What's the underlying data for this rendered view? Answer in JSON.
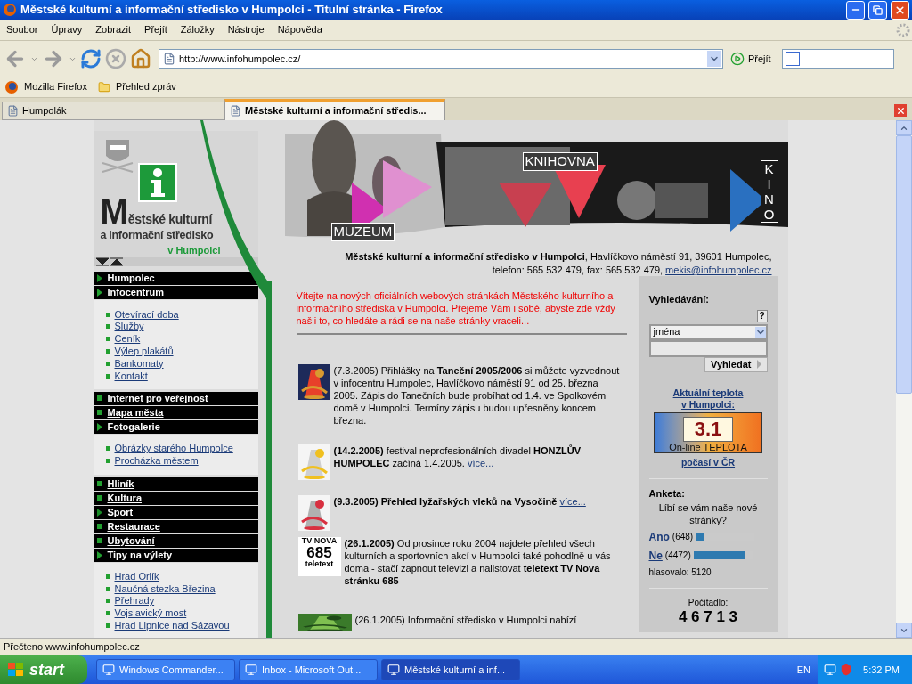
{
  "window": {
    "title": "Městské kulturní a informační středisko v Humpolci - Titulní stránka - Firefox"
  },
  "menu": [
    "Soubor",
    "Úpravy",
    "Zobrazit",
    "Přejít",
    "Záložky",
    "Nástroje",
    "Nápověda"
  ],
  "toolbar": {
    "url": "http://www.infohumpolec.cz/",
    "go": "Přejít"
  },
  "bookmarks": [
    "Mozilla Firefox",
    "Přehled zpráv"
  ],
  "tabs": [
    {
      "label": "Humpolák",
      "selected": false
    },
    {
      "label": "Městské kulturní a informační středis...",
      "selected": true
    }
  ],
  "page": {
    "logo": {
      "line1": "Městské kulturní",
      "line2": "a informační středisko",
      "line3": "v Humpolci"
    },
    "banner_labels": [
      "MUZEUM",
      "KNIHOVNA",
      "KINO"
    ],
    "address": "**Městské kulturní a informační středisko v Humpolci**, Havlíčkovo náměstí 91, 39601 Humpolec,",
    "contact": "telefon: 565 532 479, fax: 565 532 479,",
    "email": "mekis@infohumpolec.cz",
    "nav": [
      {
        "kind": "section",
        "label": "Humpolec",
        "expanded": false
      },
      {
        "kind": "section",
        "label": "Infocentrum",
        "expanded": true,
        "children": [
          "Otevírací doba",
          "Služby",
          "Ceník",
          "Výlep plakátů",
          "Bankomaty",
          "Kontakt"
        ]
      },
      {
        "kind": "link",
        "label": "Internet pro veřejnost"
      },
      {
        "kind": "link",
        "label": "Mapa města"
      },
      {
        "kind": "section",
        "label": "Fotogalerie",
        "expanded": true,
        "children": [
          "Obrázky starého Humpolce",
          "Procházka městem"
        ]
      },
      {
        "kind": "link",
        "label": "Hliník"
      },
      {
        "kind": "link",
        "label": "Kultura"
      },
      {
        "kind": "section",
        "label": "Sport",
        "expanded": false
      },
      {
        "kind": "link",
        "label": "Restaurace"
      },
      {
        "kind": "link",
        "label": "Ubytování"
      },
      {
        "kind": "section",
        "label": "Tipy na výlety",
        "expanded": true,
        "children": [
          "Hrad Orlík",
          "Naučná stezka Březina",
          "Přehrady",
          "Vojslavický most",
          "Hrad Lipnice nad Sázavou"
        ]
      }
    ],
    "welcome": "Vítejte na nových oficiálních webových stránkách Městského kulturního a informačního střediska v Humpolci. Přejeme Vám i sobě, abyste zde vždy našli to, co hledáte a rádi se na naše stránky vraceli...",
    "news": [
      {
        "text": "(7.3.2005) Přihlášky na **Taneční 2005/2006** si můžete vyzvednout v infocentru Humpolec, Havlíčkovo náměstí 91 od 25. března 2005. Zápis do Tanečních bude probíhat od 1.4. ve Spolkovém domě v Humpolci. Termíny zápisu budou upřesněny koncem března."
      },
      {
        "text": "**(14.2.2005)** festival neprofesionálních divadel **HONZLŮV HUMPOLEC** začíná 1.4.2005.",
        "link": "více..."
      },
      {
        "text": "**(9.3.2005) Přehled lyžařských vleků na Vysočině**",
        "link": "více..."
      },
      {
        "thumb": {
          "kind": "teletext",
          "lines": [
            "TV NOVA",
            "685",
            "teletext"
          ]
        },
        "text": "**(26.1.2005)** Od prosince roku 2004 najdete přehled všech kulturních a sportovních akcí v Humpolci také pohodlně u vás doma - stačí zapnout televizi a nalistovat **teletext TV Nova stránku 685**"
      },
      {
        "text": "(26.1.2005) Informační středisko v Humpolci nabízí"
      }
    ],
    "search": {
      "label": "Vyhledávání:",
      "help": "?",
      "select": "jména",
      "button": "Vyhledat"
    },
    "weather": {
      "link": [
        "Aktuální teplota",
        "v Humpolci:"
      ],
      "value": "3.1",
      "caption": "On-line TEPLOTA",
      "link2": "počasí v ČR"
    },
    "poll": {
      "title": "Anketa:",
      "question": "Líbí se vám naše nové stránky?",
      "options": [
        {
          "label": "Ano",
          "count": "(648)",
          "level": 0.13
        },
        {
          "label": "Ne",
          "count": "(4472)",
          "level": 0.87
        }
      ],
      "total": "hlasovalo: 5120"
    },
    "counter": {
      "label": "Počítadlo:",
      "value": "4 6 7 1 3"
    }
  },
  "status": "Přečteno www.infohumpolec.cz",
  "taskbar": {
    "start": "start",
    "tasks": [
      {
        "label": "Windows Commander...",
        "selected": false
      },
      {
        "label": "Inbox - Microsoft Out...",
        "selected": false
      },
      {
        "label": "Městské kulturní a inf...",
        "selected": true
      }
    ],
    "lang": "EN",
    "clock": "5:32 PM"
  }
}
